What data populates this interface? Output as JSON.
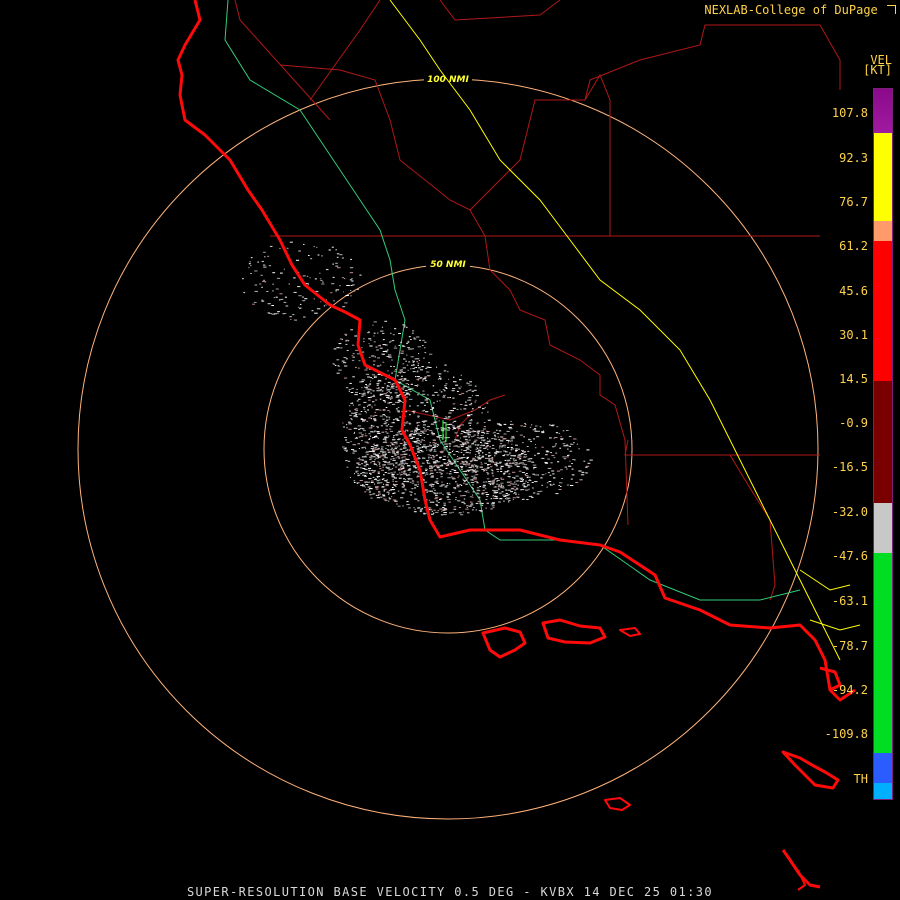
{
  "credit": "NEXLAB-College of DuPage",
  "legend": {
    "product": "VEL",
    "units": "[KT]",
    "labels": [
      "107.8",
      "92.3",
      "76.7",
      "61.2",
      "45.6",
      "30.1",
      "14.5",
      "-0.9",
      "-16.5",
      "-32.0",
      "-47.6",
      "-63.1",
      "-78.7",
      "-94.2",
      "-109.8",
      "TH"
    ],
    "colors": {
      "purple": "#8a0a8a",
      "yellow": "#ffff00",
      "salmon": "#ff9a6a",
      "red": "#ff0000",
      "dark_red": "#7a0000",
      "gray": "#c8c8c8",
      "green": "#00dd22",
      "blue": "#2a5cff",
      "cyan": "#00b0ff"
    }
  },
  "rings": {
    "inner_label": "50 NMI",
    "outer_label": "100 NMI"
  },
  "footer": "SUPER-RESOLUTION BASE VELOCITY 0.5 DEG - KVBX 14 DEC 25 01:30"
}
